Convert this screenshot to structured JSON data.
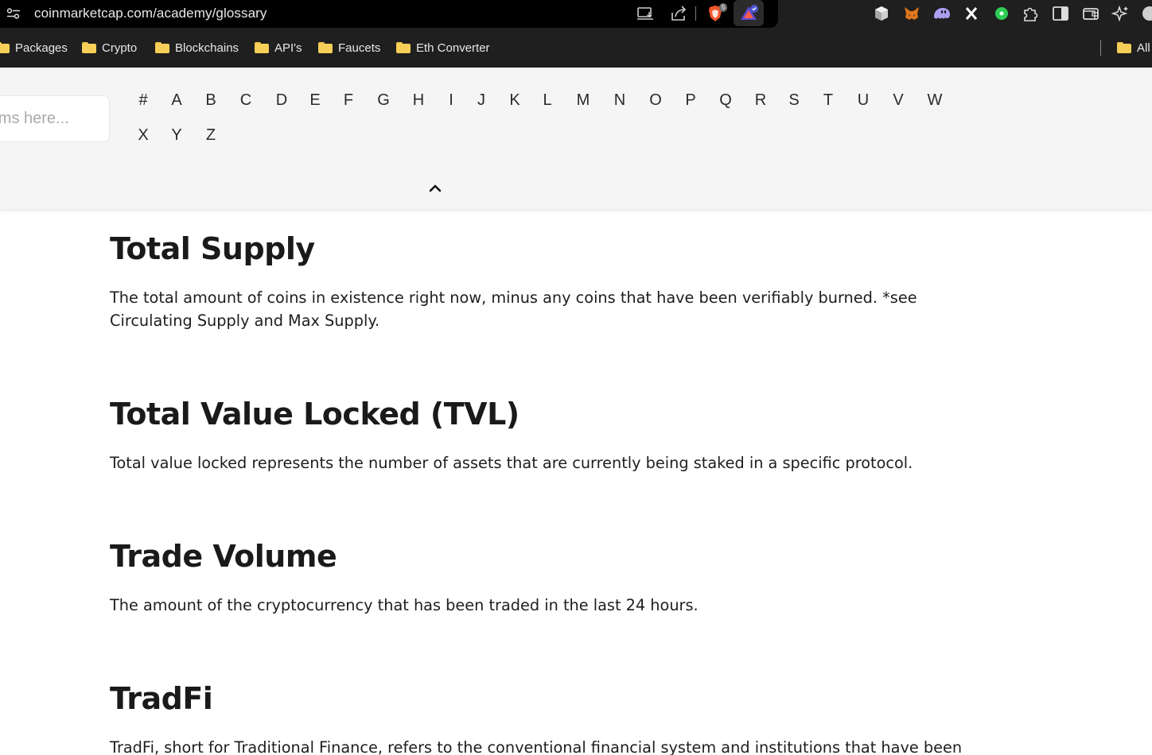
{
  "browser": {
    "url": "coinmarketcap.com/academy/glossary",
    "brave_badge": "5",
    "bookmarks": [
      "Packages",
      "Crypto",
      "Blockchains",
      "API's",
      "Faucets",
      "Eth Converter"
    ],
    "all_bookmarks_label": "All",
    "extension_icons": [
      "cube-icon",
      "metamask-fox-icon",
      "phantom-ghost-icon",
      "x-icon",
      "green-dot-icon",
      "puzzle-icon",
      "sidebar-icon",
      "wallet-icon",
      "sparkle-icon"
    ]
  },
  "glossary": {
    "search_placeholder": "erms here...",
    "letters": [
      "#",
      "A",
      "B",
      "C",
      "D",
      "E",
      "F",
      "G",
      "H",
      "I",
      "J",
      "K",
      "L",
      "M",
      "N",
      "O",
      "P",
      "Q",
      "R",
      "S",
      "T",
      "U",
      "V",
      "W",
      "X",
      "Y",
      "Z"
    ],
    "entries": [
      {
        "title": "Total Supply",
        "body": "The total amount of coins in existence right now, minus any coins that have been verifiably burned. *see Circulating Supply and Max Supply."
      },
      {
        "title": "Total Value Locked (TVL)",
        "body": "Total value locked represents the number of assets that are currently being staked in a specific protocol."
      },
      {
        "title": "Trade Volume",
        "body": "The amount of the cryptocurrency that has been traded in the last 24 hours."
      },
      {
        "title": "TradFi",
        "body": "TradFi, short for Traditional Finance, refers to the conventional financial system and institutions that have been"
      }
    ]
  },
  "colors": {
    "chrome_bg": "#1f1f1f",
    "header_bg": "#f5f5f5",
    "folder": "#f7cf58",
    "text": "#1a1a1a"
  }
}
